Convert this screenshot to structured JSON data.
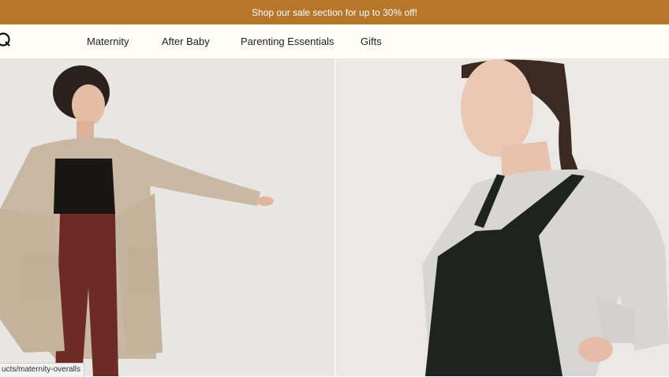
{
  "promo": {
    "text": "Shop our sale section for up to 30% off!"
  },
  "nav": {
    "logo_icon": "brand-logo-icon",
    "items": [
      {
        "label": "Maternity"
      },
      {
        "label": "After Baby"
      },
      {
        "label": "Parenting Essentials"
      },
      {
        "label": "Gifts"
      }
    ]
  },
  "hero": {
    "left_image": "model-in-oatmeal-cardigan-photo",
    "right_image": "model-in-black-overalls-photo"
  },
  "status_bar": {
    "url": "ucts/maternity-overalls"
  },
  "colors": {
    "promo_bg": "#b7772a",
    "nav_bg": "#fffdf8",
    "text": "#1e1e1e"
  }
}
